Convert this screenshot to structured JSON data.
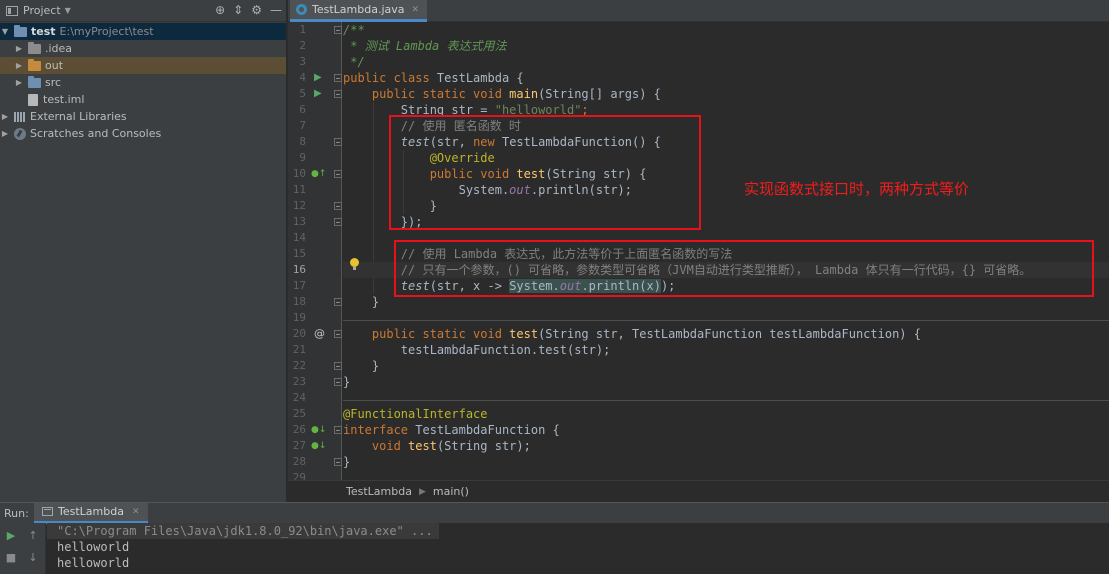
{
  "project_panel": {
    "title": "Project",
    "tree": [
      {
        "label": "test",
        "path": "E:\\myProject\\test"
      },
      {
        "label": ".idea"
      },
      {
        "label": "out"
      },
      {
        "label": "src"
      },
      {
        "label": "test.iml"
      },
      {
        "label": "External Libraries"
      },
      {
        "label": "Scratches and Consoles"
      }
    ]
  },
  "editor": {
    "tab_label": "TestLambda.java",
    "breadcrumb": [
      "TestLambda",
      "main()"
    ],
    "line_numbers": [
      "1",
      "2",
      "3",
      "4",
      "5",
      "6",
      "7",
      "8",
      "9",
      "10",
      "11",
      "12",
      "13",
      "14",
      "15",
      "16",
      "17",
      "18",
      "19",
      "20",
      "21",
      "22",
      "23",
      "24",
      "25",
      "26",
      "27",
      "28",
      "29"
    ],
    "current_line": 16
  },
  "code": {
    "l1": "/**",
    "l2": " * 测试 Lambda 表达式用法",
    "l3": " */",
    "l4_kw": "public class ",
    "l4_name": "TestLambda {",
    "l5_kw": "    public static void ",
    "l5_fn": "main",
    "l5_rest": "(String[] args) {",
    "l6_a": "        String str = ",
    "l6_str": "\"helloworld\"",
    "l6_end": ";",
    "l7": "        // 使用 匿名函数 时",
    "l8_ind": "        ",
    "l8_fn": "test",
    "l8_a": "(str, ",
    "l8_new": "new ",
    "l8_b": "TestLambdaFunction() {",
    "l9_ind": "            ",
    "l9_ann": "@Override",
    "l10_ind": "            ",
    "l10_kw": "public void ",
    "l10_fn": "test",
    "l10_rest": "(String str) {",
    "l11_a": "                System.",
    "l11_fld": "out",
    "l11_b": ".println(str);",
    "l12": "            }",
    "l13": "        });",
    "l15": "        // 使用 Lambda 表达式，此方法等价于上面匿名函数的写法",
    "l16": "        // 只有一个参数，() 可省略，参数类型可省略（JVM自动进行类型推断）， Lambda 体只有一行代码，{} 可省略。",
    "l17_ind": "        ",
    "l17_fn": "test",
    "l17_a": "(str, x -> ",
    "l17_sel_a": "System.",
    "l17_sel_fld": "out",
    "l17_sel_b": ".println(x)",
    "l17_end": ");",
    "l18": "    }",
    "l20_kw": "    public static void ",
    "l20_fn": "test",
    "l20_rest": "(String str, TestLambdaFunction testLambdaFunction) {",
    "l21": "        testLambdaFunction.test(str);",
    "l22": "    }",
    "l23": "}",
    "l25_ann": "@FunctionalInterface",
    "l26_kw": "interface ",
    "l26_rest": "TestLambdaFunction {",
    "l27_kw": "    void ",
    "l27_fn": "test",
    "l27_rest": "(String str);",
    "l28": "}"
  },
  "annotation_text": "实现函数式接口时，两种方式等价",
  "run_panel": {
    "label": "Run:",
    "tab_label": "TestLambda",
    "console": [
      "\"C:\\Program Files\\Java\\jdk1.8.0_92\\bin\\java.exe\" ...",
      "helloworld",
      "helloworld"
    ]
  },
  "colors": {
    "keyword": "#cc7832",
    "string": "#6a8759",
    "comment": "#808080",
    "annotation_box": "#e8101a"
  }
}
